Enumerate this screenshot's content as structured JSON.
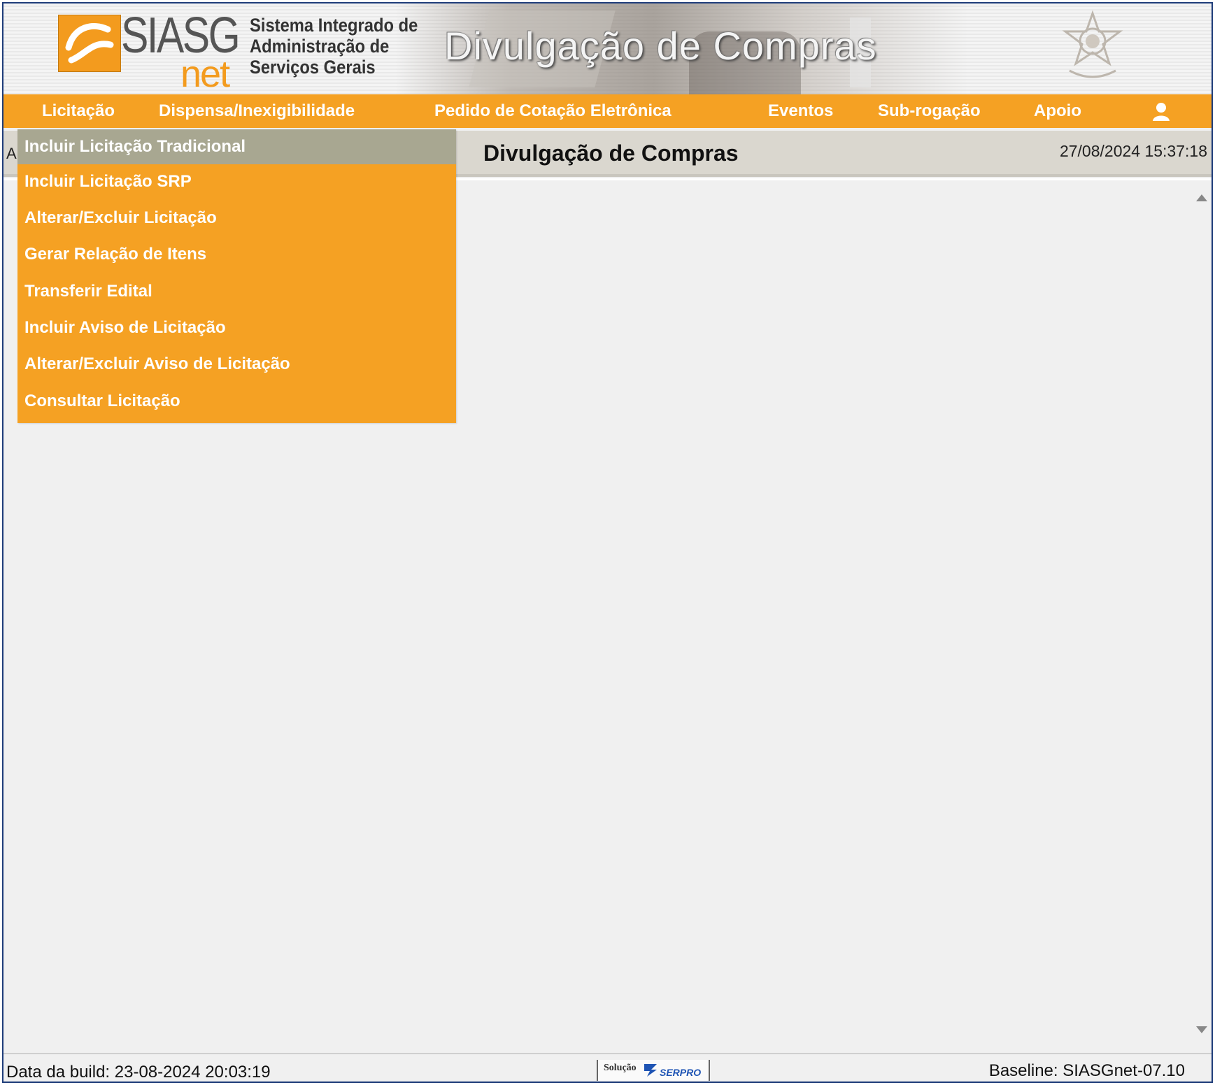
{
  "header": {
    "logo_text": "SIASG",
    "logo_suffix": "net",
    "system_name_lines": [
      "Sistema Integrado de",
      "Administração de",
      "Serviços Gerais"
    ],
    "banner_title": "Divulgação de Compras"
  },
  "menu": {
    "items": [
      {
        "label": "Licitação"
      },
      {
        "label": "Dispensa/Inexigibilidade"
      },
      {
        "label": "Pedido de Cotação Eletrônica"
      },
      {
        "label": "Eventos"
      },
      {
        "label": "Sub-rogação"
      },
      {
        "label": "Apoio"
      }
    ],
    "user_icon": "user-icon"
  },
  "dropdown": {
    "items": [
      {
        "label": "Incluir Licitação Tradicional",
        "active": true
      },
      {
        "label": "Incluir Licitação SRP"
      },
      {
        "label": "Alterar/Excluir Licitação"
      },
      {
        "label": "Gerar Relação de Itens"
      },
      {
        "label": "Transferir Edital"
      },
      {
        "label": "Incluir Aviso de Licitação"
      },
      {
        "label": "Alterar/Excluir Aviso de Licitação"
      },
      {
        "label": "Consultar Licitação"
      }
    ]
  },
  "titlebar": {
    "left_fragment": "A",
    "page_title": "Divulgação de Compras",
    "datetime": "27/08/2024 15:37:18"
  },
  "footer": {
    "build": "Data da build: 23-08-2024 20:03:19",
    "serpro_prefix": "Solução",
    "serpro_name": "SERPRO",
    "baseline": "Baseline: SIASGnet-07.10"
  },
  "colors": {
    "menu_orange": "#f5a123",
    "active_item": "#a8a791",
    "border_blue": "#1f3d7a"
  }
}
